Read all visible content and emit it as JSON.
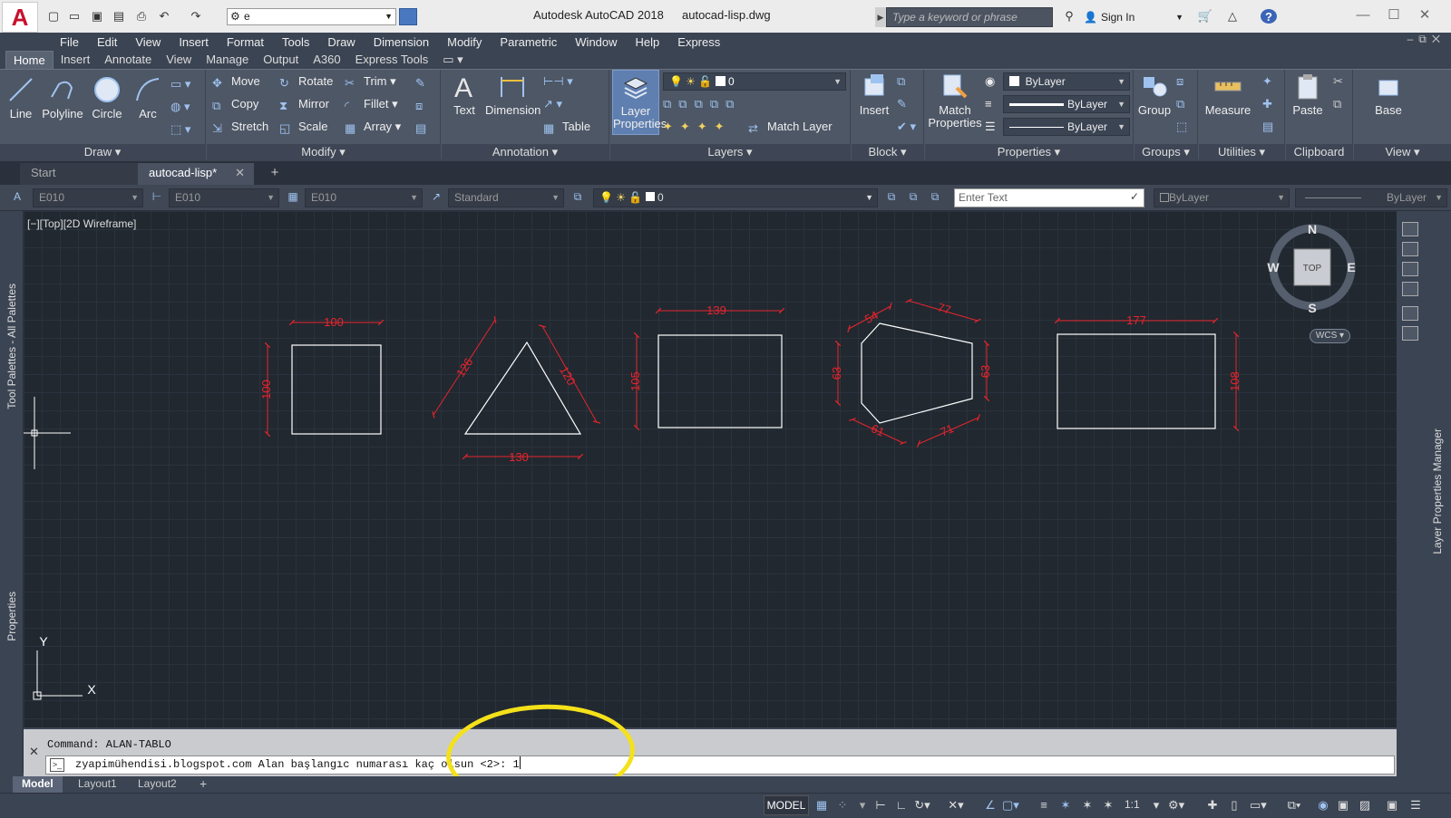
{
  "titlebar": {
    "app_title": "Autodesk AutoCAD 2018",
    "file_name": "autocad-lisp.dwg",
    "workspace": "e",
    "search_placeholder": "Type a keyword or phrase",
    "sign_in": "Sign In"
  },
  "menu": [
    "File",
    "Edit",
    "View",
    "Insert",
    "Format",
    "Tools",
    "Draw",
    "Dimension",
    "Modify",
    "Parametric",
    "Window",
    "Help",
    "Express"
  ],
  "ribbon_tabs": [
    "Home",
    "Insert",
    "Annotate",
    "View",
    "Manage",
    "Output",
    "A360",
    "Express Tools"
  ],
  "ribbon": {
    "draw": {
      "title": "Draw",
      "line": "Line",
      "polyline": "Polyline",
      "circle": "Circle",
      "arc": "Arc"
    },
    "modify": {
      "title": "Modify",
      "move": "Move",
      "rotate": "Rotate",
      "trim": "Trim",
      "copy": "Copy",
      "mirror": "Mirror",
      "fillet": "Fillet",
      "stretch": "Stretch",
      "scale": "Scale",
      "array": "Array"
    },
    "annotation": {
      "title": "Annotation",
      "text": "Text",
      "dimension": "Dimension",
      "table": "Table"
    },
    "layers": {
      "title": "Layers",
      "layer_properties_1": "Layer",
      "layer_properties_2": "Properties",
      "current_layer": "0",
      "match_layer": "Match Layer"
    },
    "block": {
      "title": "Block",
      "insert": "Insert"
    },
    "properties": {
      "title": "Properties",
      "match_1": "Match",
      "match_2": "Properties",
      "color": "ByLayer",
      "linetype": "ByLayer",
      "lineweight": "ByLayer"
    },
    "groups": {
      "title": "Groups",
      "group": "Group"
    },
    "utilities": {
      "title": "Utilities",
      "measure": "Measure"
    },
    "clipboard": {
      "title": "Clipboard",
      "paste": "Paste"
    },
    "view": {
      "title": "View",
      "base": "Base"
    }
  },
  "doc_tabs": {
    "start": "Start",
    "file": "autocad-lisp*"
  },
  "props_toolbar": {
    "textstyle": "E010",
    "dimstyle": "E010",
    "tablestyle": "E010",
    "mleader": "Standard",
    "layer": "0",
    "enter_text": "Enter Text",
    "color": "ByLayer",
    "linetype": "ByLayer"
  },
  "side": {
    "tool_palettes": "Tool Palettes - All Palettes",
    "properties": "Properties",
    "layer_manager": "Layer Properties Manager"
  },
  "viewport": {
    "label": "[−][Top][2D Wireframe]"
  },
  "viewcube": {
    "north": "N",
    "south": "S",
    "east": "E",
    "west": "W",
    "face": "TOP",
    "wcs": "WCS"
  },
  "ucs": {
    "x": "X",
    "y": "Y"
  },
  "dimensions": {
    "square": {
      "w": "100",
      "h": "100"
    },
    "triangle": {
      "left": "126",
      "right": "120",
      "base": "130"
    },
    "rect1": {
      "w": "139",
      "h": "105"
    },
    "hexagon": {
      "tl": "54",
      "tr": "77",
      "l": "63",
      "r": "63",
      "bl": "61",
      "br": "71"
    },
    "rect2": {
      "w": "177",
      "h": "108"
    }
  },
  "command": {
    "history": "Command: ALAN-TABLO",
    "input": "zyapimühendisi.blogspot.com Alan başlangıc numarası kaç olsun <2>: 1"
  },
  "layout_tabs": [
    "Model",
    "Layout1",
    "Layout2"
  ],
  "status": {
    "model": "MODEL",
    "scale": "1:1"
  },
  "colors": {
    "accent": "#c8102e",
    "dimension": "#e8242c",
    "geometry": "#ffffff",
    "highlight": "#f4e11a",
    "canvas": "#212830"
  }
}
